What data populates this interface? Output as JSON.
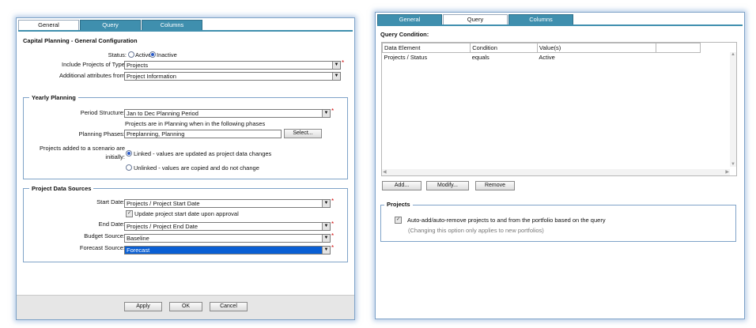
{
  "left": {
    "tabs": [
      {
        "label": "General",
        "active": true
      },
      {
        "label": "Query",
        "active": false
      },
      {
        "label": "Columns",
        "active": false
      }
    ],
    "title": "Capital Planning - General Configuration",
    "status": {
      "label": "Status:",
      "options": [
        "Active",
        "Inactive"
      ],
      "selected": "Inactive"
    },
    "include_projects": {
      "label": "Include Projects of Type:",
      "value": "Projects"
    },
    "additional_attributes": {
      "label": "Additional attributes from:",
      "value": "Project Information"
    },
    "yearly_planning": {
      "legend": "Yearly Planning",
      "period_structure": {
        "label": "Period Structure:",
        "value": "Jan to Dec Planning Period"
      },
      "phases_note": "Projects are in Planning when in the following phases",
      "planning_phases": {
        "label": "Planning Phases:",
        "value": "Preplanning, Planning",
        "button": "Select..."
      },
      "scenario_label_1": "Projects added to a scenario are",
      "scenario_label_2": "initially:",
      "scenario_options": [
        "Linked - values are updated as project data changes",
        "Unlinked - values are copied and do not change"
      ],
      "scenario_selected": 0
    },
    "project_data_sources": {
      "legend": "Project Data Sources",
      "start_date": {
        "label": "Start Date:",
        "value": "Projects / Project Start Date"
      },
      "update_start": {
        "label": "Update project start date upon approval",
        "checked": true
      },
      "end_date": {
        "label": "End Date:",
        "value": "Projects / Project End Date"
      },
      "budget_source": {
        "label": "Budget Source:",
        "value": "Baseline"
      },
      "forecast_source": {
        "label": "Forecast Source:",
        "value": "Forecast"
      }
    },
    "footer": {
      "apply": "Apply",
      "ok": "OK",
      "cancel": "Cancel"
    },
    "required_mark": "*"
  },
  "right": {
    "tabs": [
      {
        "label": "General",
        "active": false
      },
      {
        "label": "Query",
        "active": true
      },
      {
        "label": "Columns",
        "active": false
      }
    ],
    "query_condition_label": "Query Condition:",
    "grid": {
      "columns": [
        "Data Element",
        "Condition",
        "Value(s)",
        ""
      ],
      "rows": [
        [
          "Projects / Status",
          "equals",
          "Active",
          ""
        ]
      ]
    },
    "buttons": {
      "add": "Add...",
      "modify": "Modify...",
      "remove": "Remove"
    },
    "projects": {
      "legend": "Projects",
      "auto_label": "Auto-add/auto-remove projects to and from the portfolio based on the query",
      "auto_checked": true,
      "note": "(Changing this option only applies to new portfolios)"
    }
  },
  "colors": {
    "tab": "#3f8fae",
    "border": "#7fa3c8",
    "highlight": "#0a5fd4",
    "required": "#cc0000"
  }
}
